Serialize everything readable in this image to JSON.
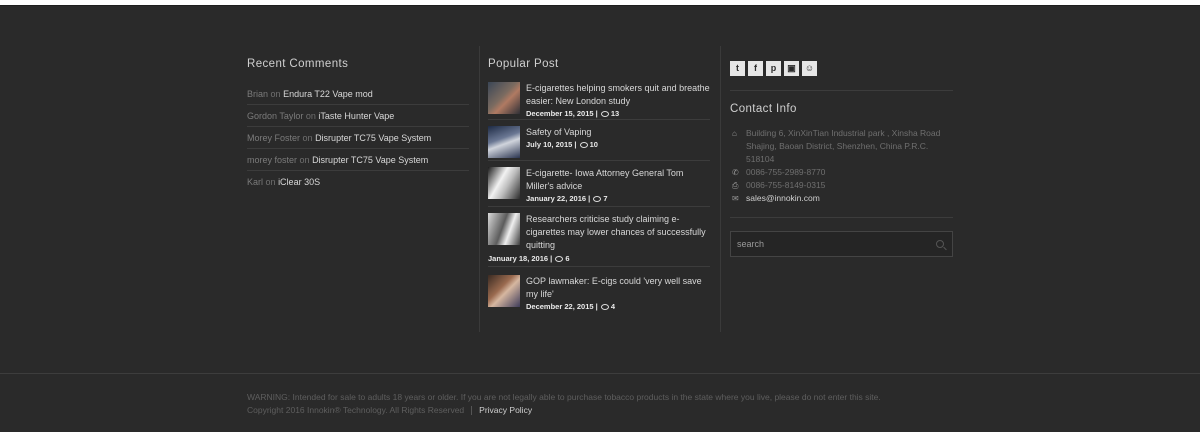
{
  "recent_comments": {
    "title": "Recent Comments",
    "items": [
      {
        "author": "Brian",
        "on": "on",
        "post": "Endura T22 Vape mod"
      },
      {
        "author": "Gordon Taylor",
        "on": "on",
        "post": "iTaste Hunter Vape"
      },
      {
        "author": "Morey Foster",
        "on": "on",
        "post": "Disrupter TC75 Vape System"
      },
      {
        "author": "morey foster",
        "on": "on",
        "post": "Disrupter TC75 Vape System"
      },
      {
        "author": "Karl",
        "on": "on",
        "post": "iClear 30S"
      }
    ]
  },
  "popular_post": {
    "title": "Popular Post",
    "items": [
      {
        "title": "E-cigarettes helping smokers quit and breathe easier: New London study",
        "date": "December 15, 2015",
        "comments": "13"
      },
      {
        "title": "Safety of Vaping",
        "date": "July 10, 2015",
        "comments": "10"
      },
      {
        "title": "E-cigarette- Iowa Attorney General Tom Miller's advice",
        "date": "January 22, 2016",
        "comments": "7"
      },
      {
        "title": "Researchers criticise study claiming e-cigarettes may lower chances of successfully quitting",
        "date": "January 18, 2016",
        "comments": "6"
      },
      {
        "title": "GOP lawmaker: E-cigs could 'very well save my life'",
        "date": "December 22, 2015",
        "comments": "4"
      }
    ]
  },
  "social": [
    {
      "icon": "twitter-icon",
      "glyph": "t"
    },
    {
      "icon": "facebook-icon",
      "glyph": "f"
    },
    {
      "icon": "pinterest-icon",
      "glyph": "p"
    },
    {
      "icon": "instagram-icon",
      "glyph": "▣"
    },
    {
      "icon": "reddit-icon",
      "glyph": "☺"
    }
  ],
  "contact": {
    "title": "Contact Info",
    "address": "Building 6, XinXinTian Industrial park , Xinsha Road Shajing, Baoan District, Shenzhen, China P.R.C. 518104",
    "phone": "0086-755-2989-8770",
    "fax": "0086-755-8149-0315",
    "email": "sales@innokin.com"
  },
  "search": {
    "placeholder": "search"
  },
  "footer": {
    "warning": "WARNING: Intended for sale to adults 18 years or older. If you are not legally able to purchase tobacco products in the state where you live, please do not enter this site.",
    "copyright": "Copyright 2016 Innokin® Technology. All Rights Reserved",
    "privacy": "Privacy Policy"
  }
}
